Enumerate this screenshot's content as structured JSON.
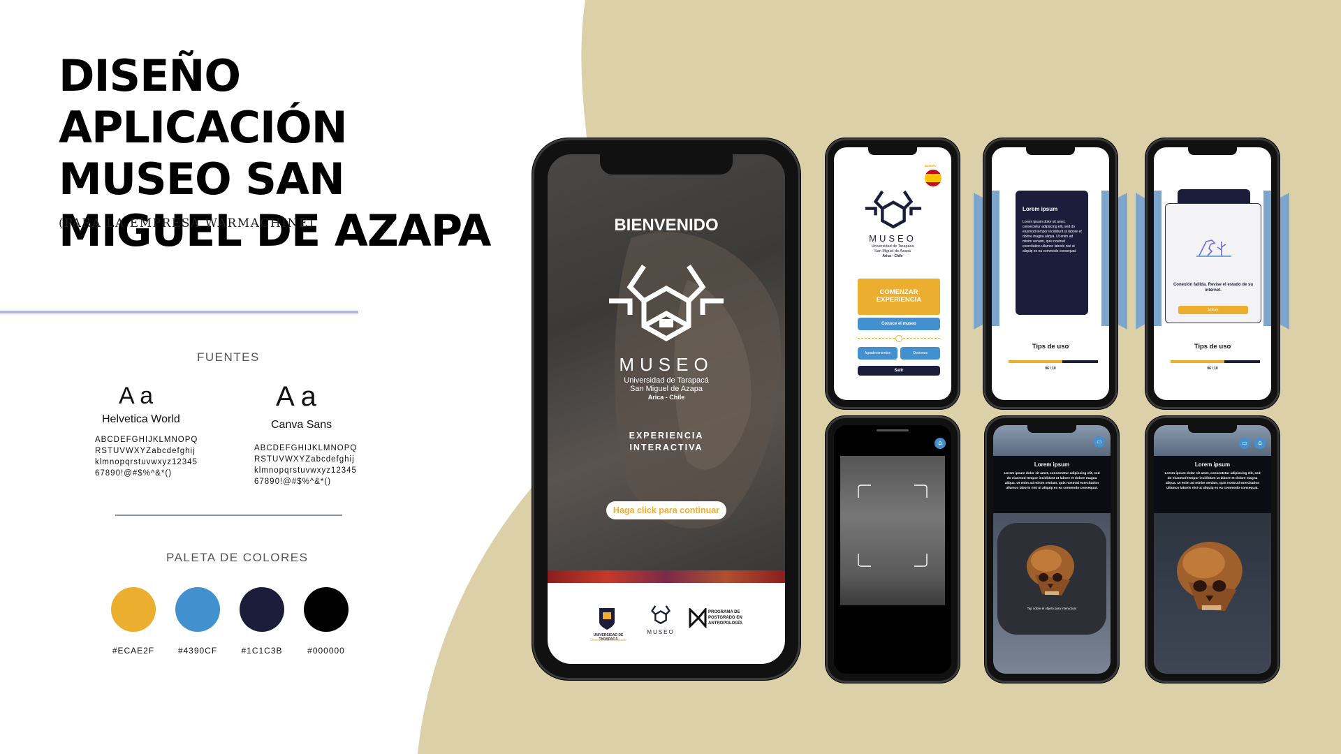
{
  "header": {
    "title": "DISEÑO APLICACIÓN MUSEO SAN MIGUEL DE AZAPA",
    "subtitle": "(PARA LA EMPRESA WARMACHINE)"
  },
  "fonts_section": {
    "heading": "FUENTES",
    "fonts": [
      {
        "sample": "A a",
        "name": "Helvetica World",
        "glyphs": "ABCDEFGHIJKLMNOPQRSTUVWXYZabcdefghijklmnopqrstuvwxyz1234567890!@#$%^&*()"
      },
      {
        "sample": "A a",
        "name": "Canva Sans",
        "glyphs": "ABCDEFGHIJKLMNOPQRSTUVWXYZabcdefghijklmnopqrstuvwxyz1234567890!@#$%^&*()"
      }
    ]
  },
  "palette_section": {
    "heading": "PALETA DE COLORES",
    "colors": [
      {
        "hex": "#ECAE2F",
        "label": "#ECAE2F"
      },
      {
        "hex": "#4390CF",
        "label": "#4390CF"
      },
      {
        "hex": "#1C1C3B",
        "label": "#1C1C3B"
      },
      {
        "hex": "#000000",
        "label": "#000000"
      }
    ]
  },
  "welcome_screen": {
    "heading": "BIENVENIDO",
    "logo_word": "MUSEO",
    "logo_lines": [
      "Universidad de Tarapacá",
      "San Miguel de Azapa",
      "Arica - Chile"
    ],
    "experience": [
      "EXPERIENCIA",
      "INTERACTIVA"
    ],
    "continue_button": "Haga click para continuar",
    "footer": {
      "uta_name": "UNIVERSIDAD DE TARAPACÁ",
      "uta_tag": "Universidad del Estado",
      "program": [
        "PROGRAMA DE",
        "POSTGRADO EN",
        "ANTROPOLOGÍA"
      ]
    }
  },
  "menu_screen": {
    "language": "IDIOMA",
    "logo_word": "MUSEO",
    "logo_lines": [
      "Universidad de Tarapacá",
      "San Miguel de Azapa",
      "Arica - Chile"
    ],
    "start_button": "COMENZAR EXPERIENCIA",
    "know_button": "Conoce el museo",
    "thanks_button": "Agradecimientos",
    "options_button": "Opciones",
    "exit_button": "Salir"
  },
  "tips_screen": {
    "card_title": "Lorem ipsum",
    "card_body": "Lorem ipsum dolor sit amet, consectetur adipiscing elit, sed do eiusmod tempor incididunt ut labore et dolore magna aliqua. Ut enim ad minim veniam, quis nostrud exercitation ullamco laboris nisi ut aliquip ex ea commodo consequat.",
    "heading": "Tips de uso",
    "progress": 0.6,
    "counter": "06 / 10"
  },
  "error_screen": {
    "message": "Conexión fallida. Revise el estado de su internet.",
    "back_button": "Volver",
    "heading": "Tips de uso",
    "progress": 0.6,
    "counter": "06 / 10"
  },
  "object_screen": {
    "title": "Lorem ipsum",
    "body": "Lorem ipsum dolor sit amet, consectetur adipiscing elit, sed do eiusmod tempor incididunt ut labore et dolore magna aliqua. Ut enim ad minim veniam, quis nostrud exercitation ullamco laboris nisi ut aliquip ex ea commodo consequat.",
    "hint": "Tap sobre el objeto para interactuar"
  },
  "object_screen_2": {
    "title": "Lorem ipsum",
    "body": "Lorem ipsum dolor sit amet, consectetur adipiscing elit, sed do eiusmod tempor incididunt ut labore et dolore magna aliqua. Ut enim ad minim veniam, quis nostrud exercitation ullamco laboris nisi ut aliquip ex ea commodo consequat."
  },
  "colors": {
    "beige": "#dcd0a8",
    "yellow": "#ECAE2F",
    "blue": "#4390CF",
    "navy": "#1C1C3B",
    "panel_blue": "#7ea6cc"
  }
}
